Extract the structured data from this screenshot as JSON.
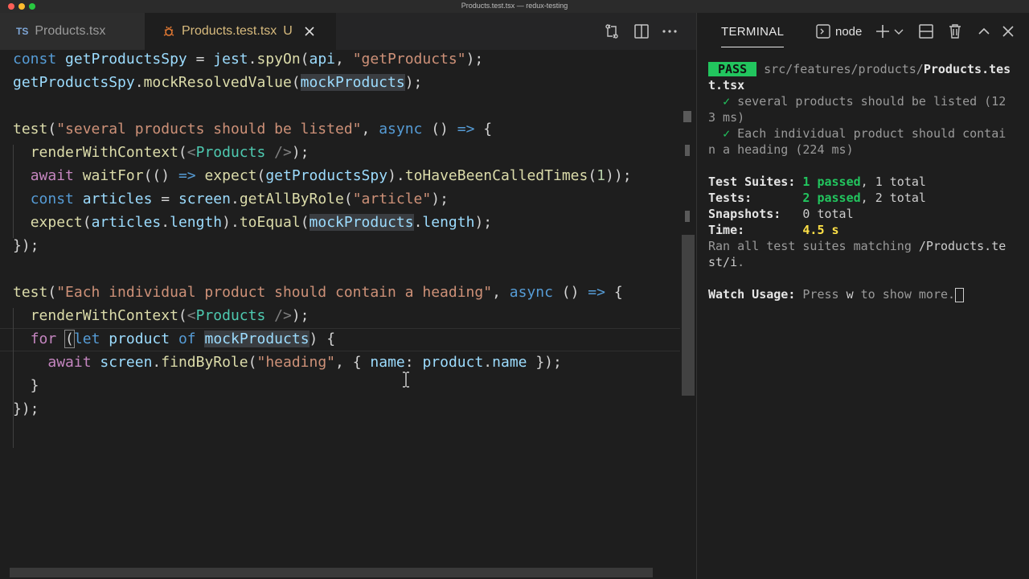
{
  "window": {
    "title": "Products.test.tsx — redux-testing",
    "colors": {
      "close": "#ff5f57",
      "minimize": "#febc2e",
      "zoom": "#28c840"
    }
  },
  "editor": {
    "tabs": [
      {
        "badge": "TS",
        "label": "Products.tsx",
        "active": false
      },
      {
        "label": "Products.test.tsx",
        "status": "U",
        "active": true
      }
    ],
    "code": {
      "l1": {
        "a": "const ",
        "b": "getProductsSpy",
        "c": " = ",
        "d": "jest",
        "e": ".",
        "f": "spyOn",
        "g": "(",
        "h": "api",
        "i": ", ",
        "j": "\"getProducts\"",
        "k": ");"
      },
      "l2": {
        "a": "getProductsSpy",
        "b": ".",
        "c": "mockResolvedValue",
        "d": "(",
        "e": "mockProducts",
        "f": ");"
      },
      "l3": {
        "a": "test",
        "b": "(",
        "c": "\"several products should be listed\"",
        "d": ", ",
        "e": "async",
        "f": " () ",
        "g": "=>",
        "h": " {"
      },
      "l4": {
        "a": "  ",
        "b": "renderWithContext",
        "c": "(",
        "d": "<",
        "e": "Products",
        "f": " />",
        "g": ");"
      },
      "l5": {
        "a": "  ",
        "b": "await",
        "c": " ",
        "d": "waitFor",
        "e": "(() ",
        "f": "=>",
        "g": " ",
        "h": "expect",
        "i": "(",
        "j": "getProductsSpy",
        "k": ").",
        "l": "toHaveBeenCalledTimes",
        "m": "(",
        "n": "1",
        "o": "));"
      },
      "l6": {
        "a": "  ",
        "b": "const",
        "c": " ",
        "d": "articles",
        "e": " = ",
        "f": "screen",
        "g": ".",
        "h": "getAllByRole",
        "i": "(",
        "j": "\"article\"",
        "k": ");"
      },
      "l7": {
        "a": "  ",
        "b": "expect",
        "c": "(",
        "d": "articles",
        "e": ".",
        "f": "length",
        "g": ").",
        "h": "toEqual",
        "i": "(",
        "j": "mockProducts",
        "k": ".",
        "l": "length",
        "m": ");"
      },
      "l8": {
        "a": "});"
      },
      "l9": {
        "a": "test",
        "b": "(",
        "c": "\"Each individual product should contain a heading\"",
        "d": ", ",
        "e": "async",
        "f": " () ",
        "g": "=>",
        "h": " {"
      },
      "l10": {
        "a": "  ",
        "b": "renderWithContext",
        "c": "(",
        "d": "<",
        "e": "Products",
        "f": " />",
        "g": ");"
      },
      "l11": {
        "a": "  ",
        "b": "for",
        "c": " ",
        "d": "(",
        "e": "let",
        "f": " ",
        "g": "product",
        "h": " ",
        "i": "of",
        "j": " ",
        "k": "mockProducts",
        "l": ") {"
      },
      "l12": {
        "a": "    ",
        "b": "await",
        "c": " ",
        "d": "screen",
        "e": ".",
        "f": "findByRole",
        "g": "(",
        "h": "\"heading\"",
        "i": ", { ",
        "j": "name",
        "k": ": ",
        "l": "product",
        "m": ".",
        "n": "name",
        "o": " });"
      },
      "l13": {
        "a": "  }"
      },
      "l14": {
        "a": "});"
      }
    }
  },
  "terminal": {
    "title": "TERMINAL",
    "shell": "node",
    "pass_badge": "PASS",
    "path_dim": "src/features/products/",
    "path_bold": "Products.tes",
    "path_cont": "t.tsx",
    "test1a": "several products should be listed (12",
    "test1b": "3 ms)",
    "test2a": "Each individual product should contai",
    "test2b": "n a heading (224 ms)",
    "check": "✓",
    "suites_label": "Test Suites:",
    "suites_passed": "1 passed",
    "suites_total": ", 1 total",
    "tests_label": "Tests:",
    "tests_passed": "2 passed",
    "tests_total": ", 2 total",
    "snap_label": "Snapshots:",
    "snap_value": "0 total",
    "time_label": "Time:",
    "time_value": "4.5 s",
    "ran_a": "Ran all test suites matching ",
    "ran_b": "/Products.te",
    "ran_c": "st/i",
    "ran_d": ".",
    "watch_label": "Watch Usage:",
    "watch_a": " Press ",
    "watch_key": "w",
    "watch_b": " to show more."
  }
}
